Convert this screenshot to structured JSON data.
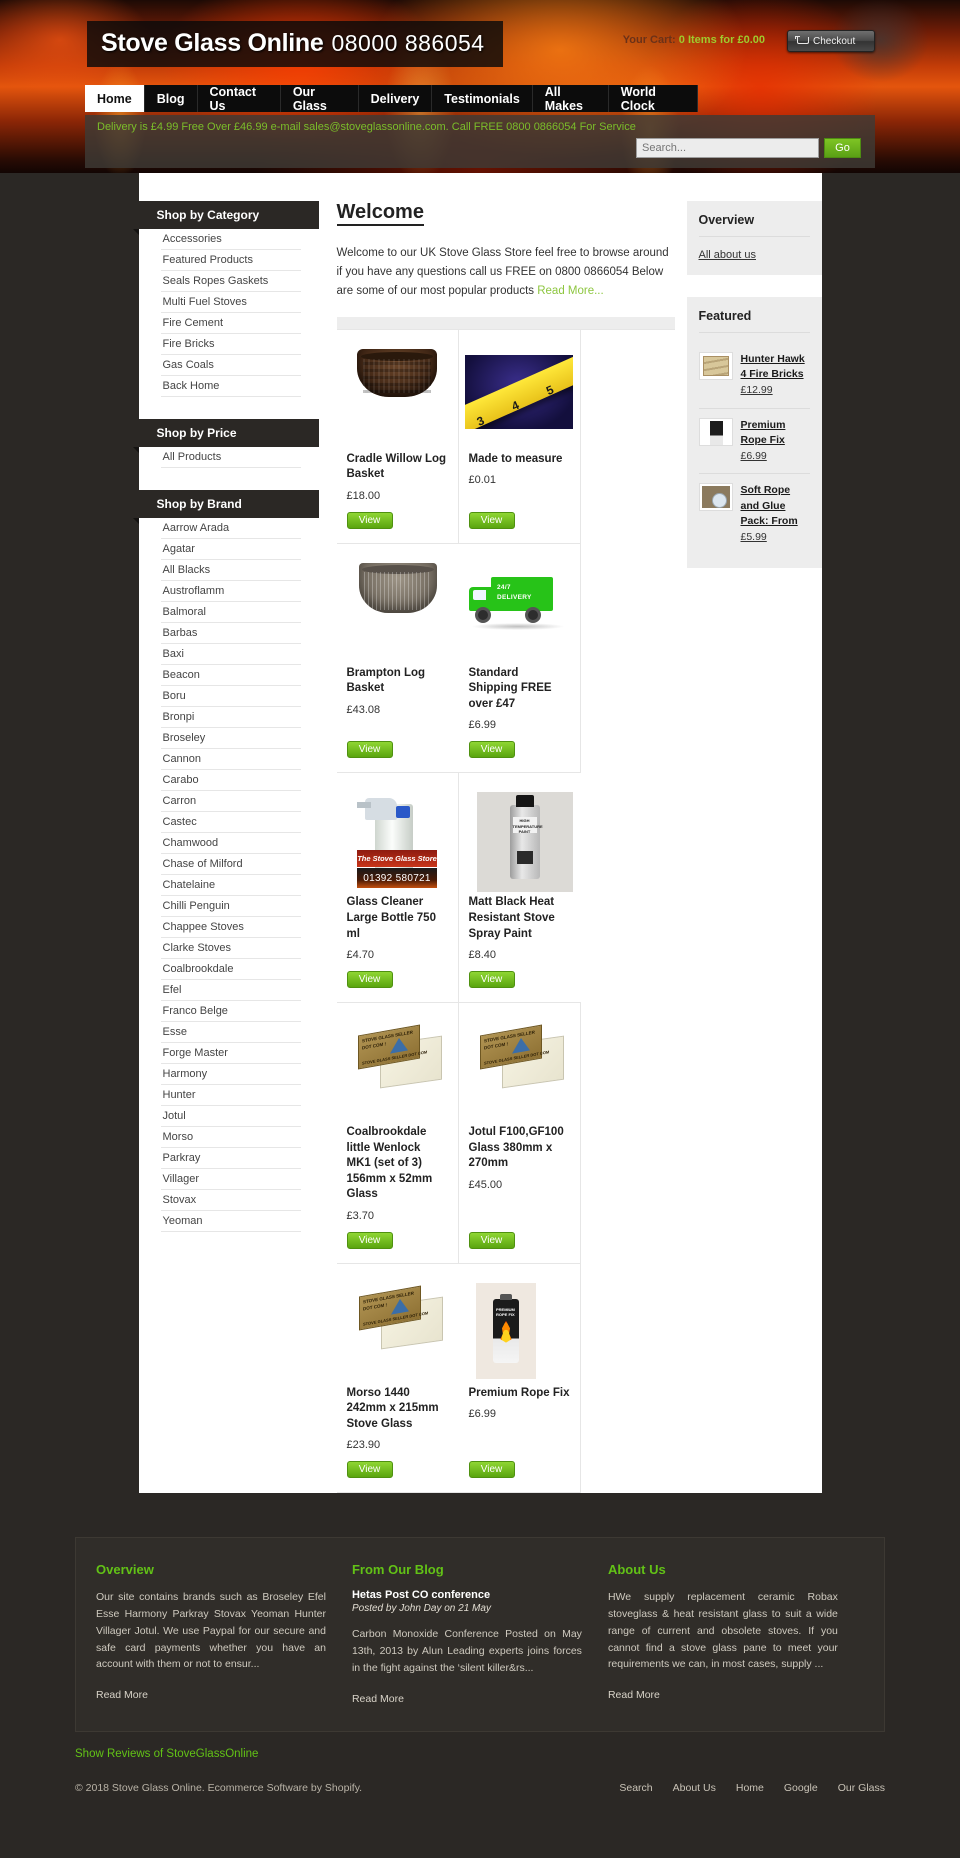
{
  "header": {
    "logo_main": "Stove Glass Online",
    "logo_phone": "08000 886054",
    "cart_label": "Your Cart:",
    "cart_status": "0 Items for £0.00",
    "checkout_label": "Checkout"
  },
  "nav": {
    "items": [
      {
        "label": "Home",
        "active": true
      },
      {
        "label": "Blog",
        "active": false
      },
      {
        "label": "Contact Us",
        "active": false
      },
      {
        "label": "Our Glass",
        "active": false
      },
      {
        "label": "Delivery",
        "active": false
      },
      {
        "label": "Testimonials",
        "active": false
      },
      {
        "label": "All Makes",
        "active": false
      },
      {
        "label": "World Clock",
        "active": false
      }
    ]
  },
  "subbar": {
    "delivery_note": "Delivery is £4.99 Free Over £46.99 e-mail sales@stoveglassonline.com. Call FREE 0800 0866054 For Service",
    "search_placeholder": "Search...",
    "search_value": "",
    "go_label": "Go"
  },
  "sidebar": {
    "category": {
      "title": "Shop by Category",
      "items": [
        "Accessories",
        "Featured Products",
        "Seals Ropes Gaskets",
        "Multi Fuel Stoves",
        "Fire Cement",
        "Fire Bricks",
        "Gas Coals",
        "Back Home"
      ]
    },
    "price": {
      "title": "Shop by Price",
      "items": [
        "All Products"
      ]
    },
    "brand": {
      "title": "Shop by Brand",
      "items": [
        "Aarrow Arada",
        "Agatar",
        "All Blacks",
        "Austroflamm",
        "Balmoral",
        "Barbas",
        "Baxi",
        "Beacon",
        "Boru",
        "Bronpi",
        "Broseley",
        "Cannon",
        "Carabo",
        "Carron",
        "Castec",
        "Chamwood",
        "Chase of Milford",
        "Chatelaine",
        "Chilli Penguin",
        "Chappee Stoves",
        "Clarke Stoves",
        "Coalbrookdale",
        "Efel",
        "Franco Belge",
        "Esse",
        "Forge Master",
        "Harmony",
        "Hunter",
        "Jotul",
        "Morso",
        "Parkray",
        "Villager",
        "Stovax",
        "Yeoman"
      ]
    }
  },
  "main": {
    "heading": "Welcome",
    "intro": "Welcome to our UK Stove Glass Store feel free to browse around if you have any questions call us FREE on 0800 0866054 Below are some of our most popular products ",
    "read_more": "Read More...",
    "view_label": "View",
    "products": [
      {
        "name": "Cradle Willow Log Basket",
        "price": "£18.00",
        "art": "basket1"
      },
      {
        "name": "Made to measure",
        "price": "£0.01",
        "art": "tape"
      },
      {
        "name": "Brampton Log Basket",
        "price": "£43.08",
        "art": "basket2"
      },
      {
        "name": "Standard Shipping FREE over £47",
        "price": "£6.99",
        "art": "truck"
      },
      {
        "name": "Glass Cleaner Large Bottle 750 ml",
        "price": "£4.70",
        "art": "cleaner"
      },
      {
        "name": "Matt Black Heat Resistant Stove Spray Paint",
        "price": "£8.40",
        "art": "spray"
      },
      {
        "name": "Coalbrookdale little Wenlock MK1 (set of 3) 156mm x 52mm Glass",
        "price": "£3.70",
        "art": "glassbox"
      },
      {
        "name": "Jotul F100,GF100 Glass 380mm x 270mm",
        "price": "£45.00",
        "art": "glassbox"
      },
      {
        "name": "Morso 1440 242mm x 215mm Stove Glass",
        "price": "£23.90",
        "art": "glassbox"
      },
      {
        "name": "Premium Rope Fix",
        "price": "£6.99",
        "art": "ropefix"
      }
    ]
  },
  "right": {
    "overview_title": "Overview",
    "overview_link": "All about us",
    "featured_title": "Featured",
    "featured": [
      {
        "name": "Hunter Hawk 4 Fire Bricks",
        "price": "£12.99",
        "art": "fb-bricks"
      },
      {
        "name": "Premium Rope Fix",
        "price": "£6.99",
        "art": "fb-tube"
      },
      {
        "name": "Soft Rope and Glue Pack: From",
        "price": "£5.99",
        "art": "fb-pack"
      }
    ]
  },
  "footer": {
    "overview": {
      "title": "Overview",
      "text": "Our site contains brands such as Broseley Efel Esse Harmony Parkray Stovax Yeoman Hunter Villager Jotul. We use Paypal for our secure and safe card payments whether you have an account with them or not to ensur...",
      "read_more": "Read More"
    },
    "blog": {
      "title": "From Our Blog",
      "post_title": "Hetas Post CO conference",
      "post_meta": "Posted by John Day on 21 May",
      "post_text": "Carbon Monoxide Conference Posted on May 13th, 2013 by Alun Leading experts joins forces in the fight against the ‘silent killer&rs...",
      "read_more": "Read More"
    },
    "about": {
      "title": "About Us",
      "text": "HWe supply replacement ceramic Robax stoveglass & heat resistant glass to suit a wide range of current and obsolete stoves. If you cannot find a stove glass pane to meet your requirements we can, in most cases, supply ...",
      "read_more": "Read More"
    },
    "reviews_link": "Show Reviews of StoveGlassOnline",
    "copyright": "© 2018 Stove Glass Online. Ecommerce Software by Shopify.",
    "links": [
      "Search",
      "About Us",
      "Home",
      "Google",
      "Our Glass"
    ]
  }
}
